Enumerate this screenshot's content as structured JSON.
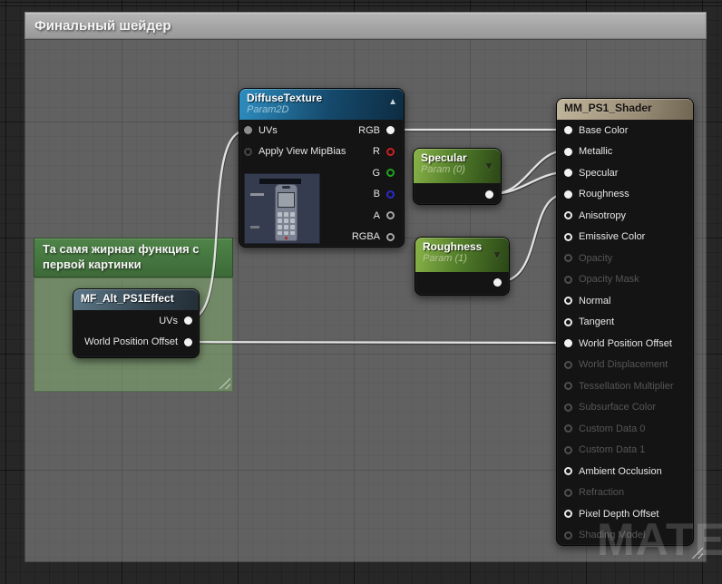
{
  "canvas": {
    "watermark": "MATERIAL"
  },
  "icons": {
    "collapse_up": "▲",
    "dropdown": "▼"
  },
  "comments": {
    "main": {
      "title": "Финальный шейдер"
    },
    "function": {
      "title": "Та самя жирная функция с первой картинки"
    }
  },
  "nodes": {
    "diffuse": {
      "title": "DiffuseTexture",
      "subtitle": "Param2D",
      "inputs": [
        {
          "label": "UVs",
          "state": "connected"
        },
        {
          "label": "Apply View MipBias",
          "state": "open"
        }
      ],
      "outputs": [
        {
          "label": "RGB",
          "state": "connected",
          "color": "#ffffff"
        },
        {
          "label": "R",
          "state": "open",
          "color": "#cc2020"
        },
        {
          "label": "G",
          "state": "open",
          "color": "#1fa41f"
        },
        {
          "label": "B",
          "state": "open",
          "color": "#2a2acc"
        },
        {
          "label": "A",
          "state": "open",
          "color": "#a6a6a6"
        },
        {
          "label": "RGBA",
          "state": "open",
          "color": "#a6a6a6"
        }
      ]
    },
    "specular": {
      "title": "Specular",
      "subtitle": "Param (0)"
    },
    "roughness": {
      "title": "Roughness",
      "subtitle": "Param (1)"
    },
    "mf": {
      "title": "MF_Alt_PS1Effect",
      "outputs": [
        {
          "label": "UVs",
          "state": "connected"
        },
        {
          "label": "World Position Offset",
          "state": "connected"
        }
      ]
    },
    "mm": {
      "title": "MM_PS1_Shader",
      "pins": [
        {
          "label": "Base Color",
          "state": "connected"
        },
        {
          "label": "Metallic",
          "state": "connected"
        },
        {
          "label": "Specular",
          "state": "connected"
        },
        {
          "label": "Roughness",
          "state": "connected"
        },
        {
          "label": "Anisotropy",
          "state": "open"
        },
        {
          "label": "Emissive Color",
          "state": "open"
        },
        {
          "label": "Opacity",
          "state": "disabled"
        },
        {
          "label": "Opacity Mask",
          "state": "disabled"
        },
        {
          "label": "Normal",
          "state": "open"
        },
        {
          "label": "Tangent",
          "state": "open"
        },
        {
          "label": "World Position Offset",
          "state": "connected"
        },
        {
          "label": "World Displacement",
          "state": "disabled"
        },
        {
          "label": "Tessellation Multiplier",
          "state": "disabled"
        },
        {
          "label": "Subsurface Color",
          "state": "disabled"
        },
        {
          "label": "Custom Data 0",
          "state": "disabled"
        },
        {
          "label": "Custom Data 1",
          "state": "disabled"
        },
        {
          "label": "Ambient Occlusion",
          "state": "open"
        },
        {
          "label": "Refraction",
          "state": "disabled"
        },
        {
          "label": "Pixel Depth Offset",
          "state": "open"
        },
        {
          "label": "Shading Model",
          "state": "disabled"
        }
      ]
    }
  },
  "colors": {
    "diffuse_header": "#1f7fb2",
    "param_header": "#6f9f3c",
    "mf_header": "#4d6576",
    "mm_header": "#b3a78c",
    "comment_green": "#4a7b44",
    "wire": "#e0e0e0"
  }
}
